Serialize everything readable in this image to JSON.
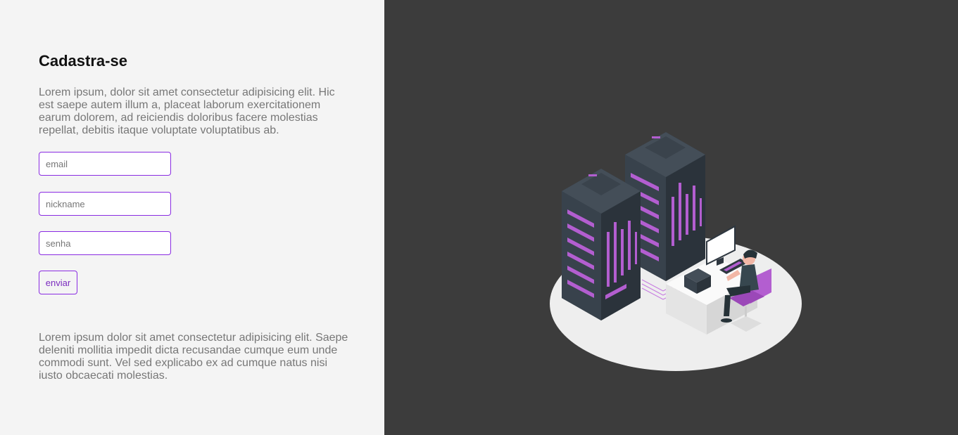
{
  "form": {
    "title": "Cadastra-se",
    "intro": "Lorem ipsum, dolor sit amet consectetur adipisicing elit. Hic est saepe autem illum a, placeat laborum exercitationem earum dolorem, ad reiciendis doloribus facere molestias repellat, debitis itaque voluptate voluptatibus ab.",
    "email_placeholder": "email",
    "nickname_placeholder": "nickname",
    "password_placeholder": "senha",
    "submit_label": "enviar",
    "outro": "Lorem ipsum dolor sit amet consectetur adipisicing elit. Saepe deleniti mollitia impedit dicta recusandae cumque eum unde commodi sunt. Vel sed explicabo ex ad cumque natus nisi iusto obcaecati molestias."
  },
  "colors": {
    "accent": "#8a2be2",
    "left_bg": "#f4f4f4",
    "right_bg": "#3c3c3c",
    "server_purple": "#b35ed0"
  },
  "illustration": {
    "icon": "server-room-illustration"
  }
}
